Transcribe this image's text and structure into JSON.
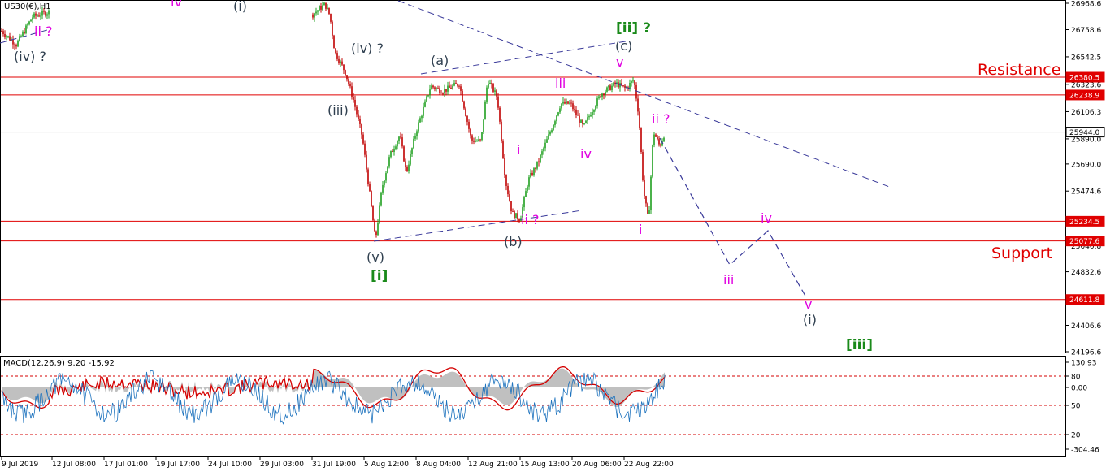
{
  "chart_data": [
    {
      "type": "candlestick",
      "symbol_label": "US30(€),H1",
      "y_ticks": [
        "26968.6",
        "26758.6",
        "26542.5",
        "26323.6",
        "26106.3",
        "25890.0",
        "25690.0",
        "25474.6",
        "25255.3",
        "25040.8",
        "24832.6",
        "24611.8",
        "24406.6",
        "24196.6"
      ],
      "ylim": [
        24196.6,
        26968.6
      ],
      "price_levels": [
        {
          "name": "resistance-upper",
          "value": "26380.5",
          "color": "#e00000"
        },
        {
          "name": "resistance-lower",
          "value": "26238.9",
          "color": "#e00000"
        },
        {
          "name": "current-price",
          "value": "25944.0",
          "color": "#000000"
        },
        {
          "name": "support-upper",
          "value": "25234.5",
          "color": "#e00000"
        },
        {
          "name": "support-lower",
          "value": "25077.6",
          "color": "#e00000"
        },
        {
          "name": "target",
          "value": "24611.8",
          "color": "#e00000"
        }
      ],
      "zone_labels": {
        "resistance": "Resistance",
        "support": "Support"
      },
      "wave_labels": [
        {
          "text": "iv",
          "color": "#e000e0"
        },
        {
          "text": "(i)",
          "color": "#2f3f4f"
        },
        {
          "text": "ii ?",
          "color": "#e000e0"
        },
        {
          "text": "(iv) ?",
          "color": "#2f3f4f"
        },
        {
          "text": "(iv) ?",
          "color": "#2f3f4f"
        },
        {
          "text": "(iii)",
          "color": "#2f3f4f"
        },
        {
          "text": "(v)",
          "color": "#2f3f4f"
        },
        {
          "text": "[i]",
          "color": "#1a8a1a"
        },
        {
          "text": "(a)",
          "color": "#2f3f4f"
        },
        {
          "text": "(b)",
          "color": "#2f3f4f"
        },
        {
          "text": "(c)",
          "color": "#2f3f4f"
        },
        {
          "text": "[ii] ?",
          "color": "#1a8a1a"
        },
        {
          "text": "v",
          "color": "#e000e0"
        },
        {
          "text": "iii",
          "color": "#e000e0"
        },
        {
          "text": "i",
          "color": "#e000e0"
        },
        {
          "text": "ii ?",
          "color": "#e000e0"
        },
        {
          "text": "iv",
          "color": "#e000e0"
        },
        {
          "text": "i",
          "color": "#e000e0"
        },
        {
          "text": "ii ?",
          "color": "#e000e0"
        },
        {
          "text": "iii",
          "color": "#e000e0"
        },
        {
          "text": "iv",
          "color": "#e000e0"
        },
        {
          "text": "v",
          "color": "#e000e0"
        },
        {
          "text": "(i)",
          "color": "#2f3f4f"
        },
        {
          "text": "[iii]",
          "color": "#1a8a1a"
        }
      ],
      "x_ticks": [
        "9 Jul 2019",
        "12 Jul 08:00",
        "17 Jul 01:00",
        "19 Jul 17:00",
        "24 Jul 10:00",
        "29 Jul 03:00",
        "31 Jul 19:00",
        "5 Aug 12:00",
        "8 Aug 04:00",
        "12 Aug 21:00",
        "15 Aug 13:00",
        "20 Aug 06:00",
        "22 Aug 22:00"
      ],
      "colors": {
        "bull": "#1fa01f",
        "bear": "#c00000",
        "trendline": "#3a3a9a",
        "projection": "#3a3a9a",
        "level": "#e00000"
      }
    },
    {
      "type": "line",
      "indicator_label": "MACD(12,26,9) 9.20 -15.92",
      "y_ticks": [
        "130.93",
        "80",
        "0.00",
        "50",
        "20",
        "-304.46"
      ],
      "series": [
        {
          "name": "MACD",
          "color": "#1e73be"
        },
        {
          "name": "Signal",
          "color": "#d40000"
        }
      ],
      "histogram_color": "#c0c0c0"
    }
  ]
}
